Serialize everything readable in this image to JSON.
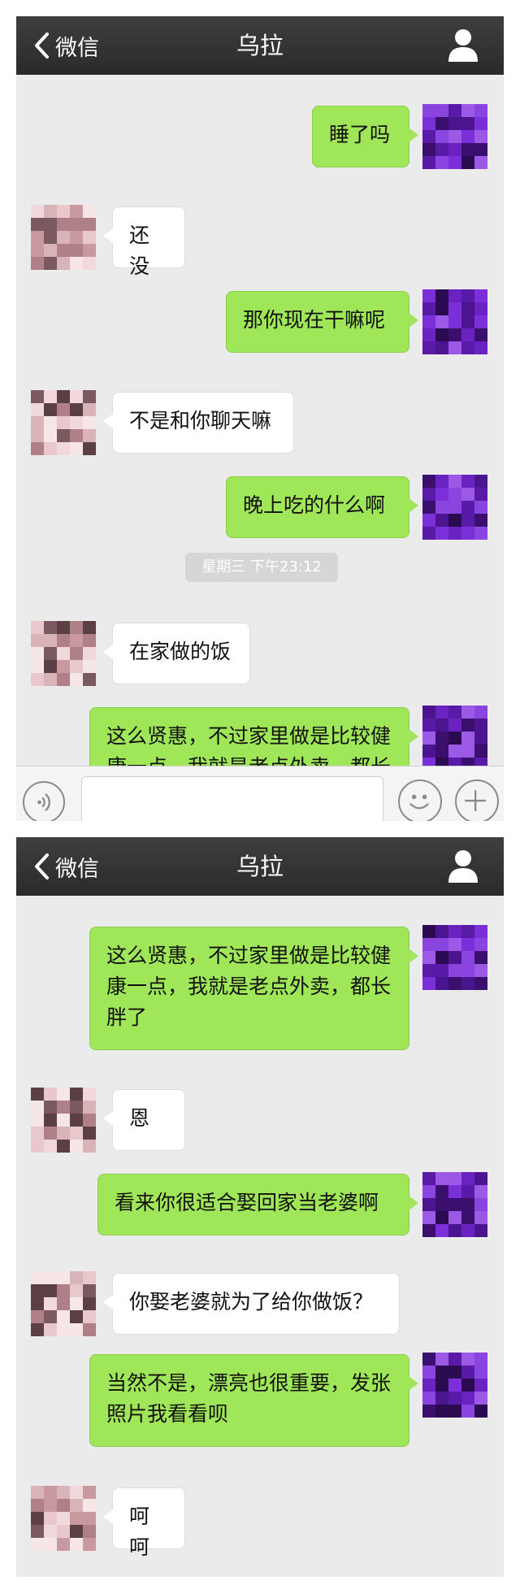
{
  "header": {
    "back_label": "微信",
    "title": "乌拉"
  },
  "screen1": {
    "messages": [
      {
        "from": "me",
        "text": "睡了吗"
      },
      {
        "from": "them",
        "text": "还没"
      },
      {
        "from": "me",
        "text": "那你现在干嘛呢"
      },
      {
        "from": "them",
        "text": "不是和你聊天嘛"
      },
      {
        "from": "me",
        "text": "晚上吃的什么啊"
      },
      {
        "from": "them",
        "text": "在家做的饭"
      },
      {
        "from": "me",
        "text": "这么贤惠，不过家里做是比较健康一点，我就是老点外卖，都长胖了"
      }
    ],
    "timestamp": "星期三 下午23:12",
    "input_placeholder": ""
  },
  "screen2": {
    "messages": [
      {
        "from": "me",
        "text": "这么贤惠，不过家里做是比较健康一点，我就是老点外卖，都长胖了"
      },
      {
        "from": "them",
        "text": "恩"
      },
      {
        "from": "me",
        "text": "看来你很适合娶回家当老婆啊"
      },
      {
        "from": "them",
        "text": "你娶老婆就为了给你做饭？"
      },
      {
        "from": "me",
        "text": "当然不是，漂亮也很重要，发张照片我看看呗"
      },
      {
        "from": "them",
        "text": "呵呵"
      }
    ]
  },
  "icons": {
    "back": "chevron-left-icon",
    "profile": "person-icon",
    "voice": "voice-icon",
    "emoji": "smiley-icon",
    "plus": "plus-icon"
  },
  "colors": {
    "header_bg": "#353537",
    "chat_bg": "#ebebeb",
    "my_bubble": "#9fe658",
    "their_bubble": "#ffffff",
    "timestamp_bg": "#d6d6d6"
  }
}
